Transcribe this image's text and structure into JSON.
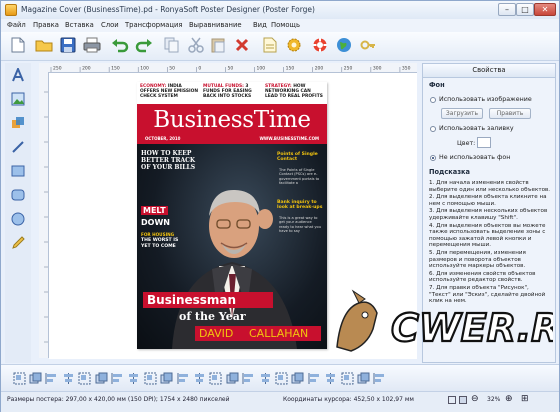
{
  "window": {
    "title": "Magazine Cover (BusinessTime).pd - RonyaSoft Poster Designer (Poster Forge)",
    "minimize": "–",
    "maximize": "□",
    "close": "✕"
  },
  "menu": {
    "items": [
      "Файл",
      "Правка",
      "Вставка",
      "Слои",
      "Трансформация",
      "Выравнивание",
      "Вид",
      "Помощь"
    ]
  },
  "toolbar": {
    "icons": [
      "new-file-icon",
      "open-folder-icon",
      "save-icon",
      "print-icon",
      "undo-icon",
      "redo-icon",
      "copy-icon",
      "cut-icon",
      "paste-icon",
      "delete-icon",
      "page-settings-icon",
      "gear-icon",
      "help-lifebuoy-icon",
      "web-globe-icon",
      "key-icon"
    ]
  },
  "left_tools": {
    "icons": [
      "text-tool-icon",
      "image-tool-icon",
      "clipart-tool-icon",
      "line-tool-icon",
      "rectangle-tool-icon",
      "rounded-rect-tool-icon",
      "ellipse-tool-icon",
      "pencil-tool-icon"
    ]
  },
  "ruler": {
    "labels": [
      "250",
      "200",
      "150",
      "100",
      "50",
      "0",
      "50",
      "100",
      "150",
      "200",
      "250",
      "300",
      "350"
    ]
  },
  "poster": {
    "top_teasers": [
      {
        "label": "ECONOMY:",
        "text": "INDIA OFFERS NEW EMISSION CHECK SYSTEM"
      },
      {
        "label": "MUTUAL FUNDS:",
        "text": "3 FUNDS FOR EASING BACK INTO STOCKS"
      },
      {
        "label": "STRATEGY:",
        "text": "HOW NETWORKING CAN LEAD TO REAL PROFITS"
      }
    ],
    "masthead": "BusinessTime",
    "date": "OCTOBER, 2010",
    "url": "WWW.BUSINESSTIME.COM",
    "left_headline": "HOW TO KEEP BETTER TRACK OF YOUR BILLS",
    "melt": "MELT",
    "down": "DOWN",
    "housing_label": "FOR HOUSING",
    "housing_text": "THE WORST IS YET TO COME",
    "right_box_title": "Points of Single Contact",
    "right_box_text": "The Points of Single Contact (PSCs) are e-government portals to facilitate a",
    "right_mid_title": "Bank inquiry to look at break-ups",
    "right_mid_text": "This is a great way to get your audience ready to hear what you have to say",
    "banner": "Businessman",
    "subbanner": "of the Year",
    "name_first": "DAVID",
    "name_last": "CALLAHAN"
  },
  "properties": {
    "title": "Свойства",
    "background_section": "Фон",
    "use_image": "Использовать изображение",
    "load_button": "Загрузить",
    "edit_button": "Править",
    "use_fill": "Использовать заливку",
    "color_label": "Цвет:",
    "no_background": "Не использовать фон",
    "hint_section": "Подсказка",
    "hints": [
      "1. Для начала изменения свойств выберите один или несколько объектов.",
      "2. Для выделения объекта кликните на нем с помощью мыши.",
      "3. Для выделения нескольких объектов удерживайте клавишу \"Shift\".",
      "4. Для выделения объектов вы можете также использовать выделение зоны с помощью зажатой левой кнопки и перемещения мыши.",
      "5. Для перемещения, изменения размеров и поворота объектов используйте маркеры объектов.",
      "6. Для изменения свойств объектов используйте редактор свойств.",
      "7. Для правки объекта \"Рисунок\", \"Текст\" или \"Эскиз\", сделайте двойной клик на нем."
    ]
  },
  "bottom_tools": {
    "icons": [
      "group-icon",
      "ungroup-icon",
      "align-left-icon",
      "align-center-icon",
      "align-right-icon",
      "align-top-icon",
      "align-middle-icon",
      "align-bottom-icon",
      "bring-front-icon",
      "send-back-icon",
      "bring-forward-icon",
      "send-backward-icon",
      "flip-h-icon",
      "flip-v-icon",
      "rotate-left-icon",
      "rotate-right-icon",
      "distribute-h-icon",
      "distribute-v-icon",
      "same-width-icon",
      "same-height-icon",
      "same-size-icon",
      "lock-icon",
      "unlock-icon"
    ]
  },
  "status": {
    "poster_size": "Размеры постера: 297,00 x 420,00 мм (150 DPI); 1754 x 2480 пикселей",
    "cursor": "Координаты курсора: 452,50 x 102,97 мм",
    "zoom": "32%"
  },
  "watermark": {
    "text": "CWER.RU"
  },
  "colors": {
    "accent": "#1f3a6e",
    "poster_red": "#c8102e",
    "poster_yellow": "#f2c30f",
    "chrome": "#e9f0fb"
  }
}
